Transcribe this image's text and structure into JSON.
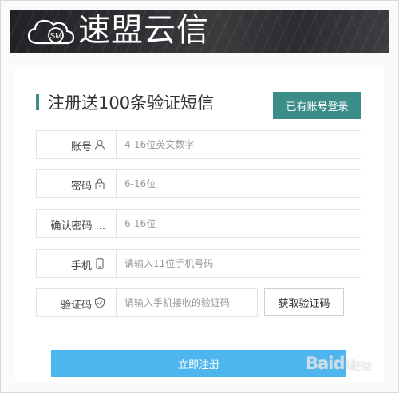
{
  "header": {
    "brand": "速盟云信",
    "logo_mark": "SM",
    "logo_icon": "cloud-logo-icon"
  },
  "form": {
    "title": "注册送100条验证短信",
    "login_button": "已有账号登录",
    "fields": [
      {
        "label": "账号",
        "icon": "user-icon",
        "placeholder": "4-16位英文数字"
      },
      {
        "label": "密码",
        "icon": "lock-icon",
        "placeholder": "6-16位"
      },
      {
        "label": "确认密码 ...",
        "placeholder": "6-16位"
      },
      {
        "label": "手机",
        "icon": "mobile-icon",
        "placeholder": "请输入11位手机号码"
      },
      {
        "label": "验证码",
        "icon": "shield-check-icon",
        "placeholder": "请输入手机接收的验证码"
      }
    ],
    "get_code_button": "获取验证码",
    "submit_button": "立即注册"
  },
  "watermark": {
    "text": "Baidu",
    "sub": "经验"
  },
  "colors": {
    "accent_teal": "#3b8d8a",
    "submit_blue": "#4eb6ee",
    "banner_dark": "#2e3033"
  }
}
